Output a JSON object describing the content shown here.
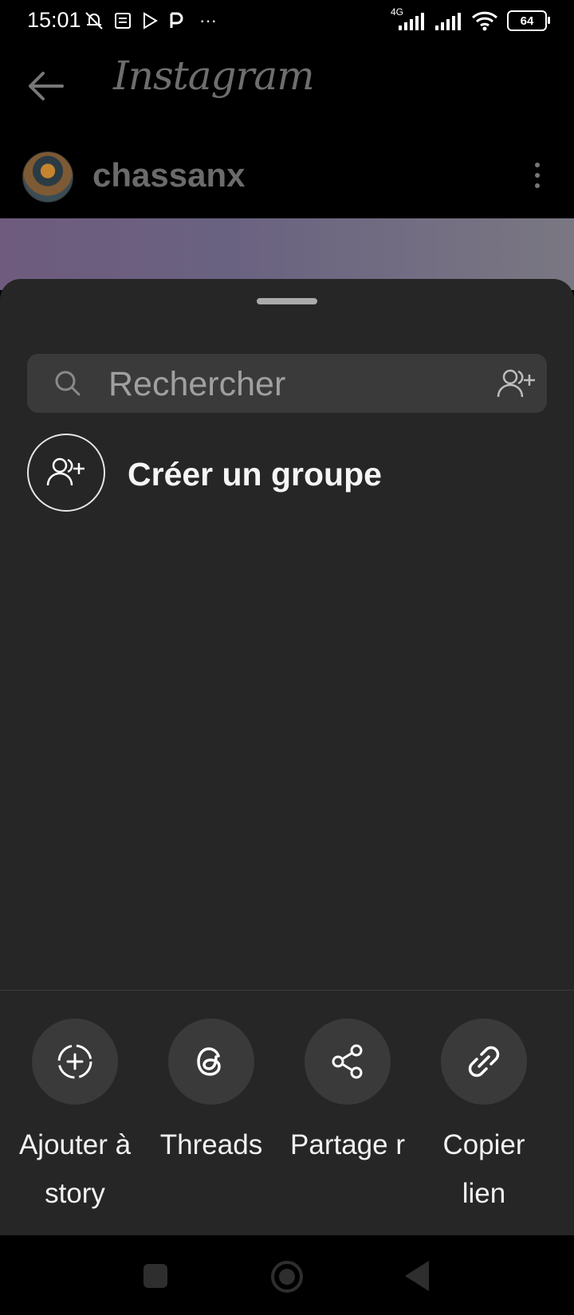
{
  "status_bar": {
    "time": "15:01",
    "network_label": "4G",
    "battery": "64",
    "overflow": "···"
  },
  "header": {
    "app_title": "Instagram",
    "username": "chassanx"
  },
  "sheet": {
    "search_placeholder": "Rechercher",
    "create_group_label": "Créer un groupe"
  },
  "actions": [
    {
      "label": "Ajouter à story",
      "icon": "add-story-icon"
    },
    {
      "label": "Threads",
      "icon": "threads-icon"
    },
    {
      "label": "Partage r",
      "icon": "share-icon"
    },
    {
      "label": "Copier lien",
      "icon": "link-icon"
    }
  ],
  "colors": {
    "sheet_bg": "#262626",
    "search_bg": "#3a3a3a",
    "action_circle_bg": "#3a3a3a"
  }
}
